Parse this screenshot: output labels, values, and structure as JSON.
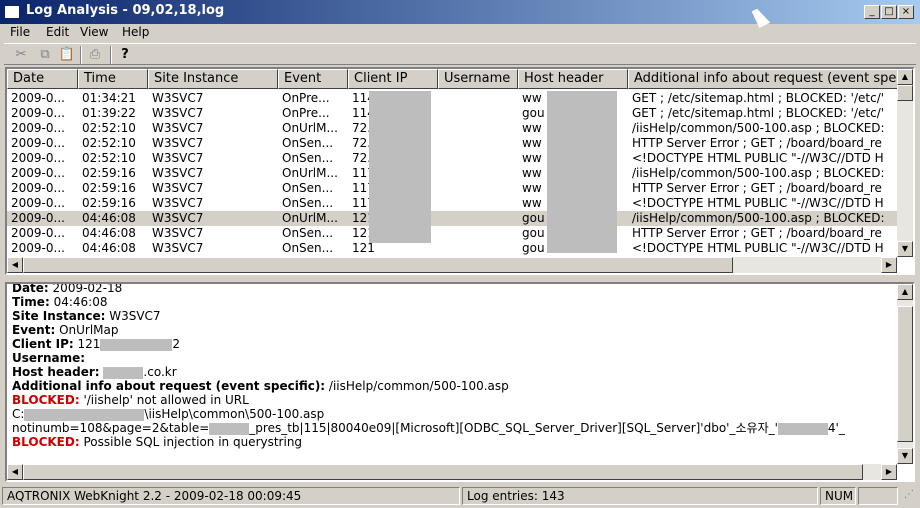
{
  "window": {
    "title": "Log Analysis - 09,02,18,log"
  },
  "menu": [
    "File",
    "Edit",
    "View",
    "Help"
  ],
  "toolbar": {
    "tools": [
      {
        "icon": "cut-icon",
        "glyph": "✂",
        "enabled": false
      },
      {
        "icon": "copy-icon",
        "glyph": "⧉",
        "enabled": false
      },
      {
        "icon": "paste-icon",
        "glyph": "📋",
        "enabled": false
      },
      {
        "icon": "print-icon",
        "glyph": "⎙",
        "enabled": false
      },
      {
        "icon": "help-icon",
        "glyph": "?",
        "enabled": true
      }
    ]
  },
  "table": {
    "columns": [
      "Date",
      "Time",
      "Site Instance",
      "Event",
      "Client IP",
      "Username",
      "Host header",
      "Additional info about request (event specific)"
    ],
    "rows": [
      [
        "2009-0...",
        "01:34:21",
        "W3SVC7",
        "OnPre...",
        "114",
        "",
        "ww",
        "GET ; /etc/sitemap.html ; BLOCKED: '/etc/'"
      ],
      [
        "2009-0...",
        "01:39:22",
        "W3SVC7",
        "OnPre...",
        "114",
        "",
        "gou",
        "GET ; /etc/sitemap.html ; BLOCKED: '/etc/'"
      ],
      [
        "2009-0...",
        "02:52:10",
        "W3SVC7",
        "OnUrlM...",
        "72.",
        "",
        "ww",
        "/iisHelp/common/500-100.asp ; BLOCKED:"
      ],
      [
        "2009-0...",
        "02:52:10",
        "W3SVC7",
        "OnSen...",
        "72.",
        "",
        "ww",
        "HTTP Server Error ; GET ; /board/board_re"
      ],
      [
        "2009-0...",
        "02:52:10",
        "W3SVC7",
        "OnSen...",
        "72.",
        "",
        "ww",
        "  <!DOCTYPE HTML PUBLIC \"-//W3C//DTD H"
      ],
      [
        "2009-0...",
        "02:59:16",
        "W3SVC7",
        "OnUrlM...",
        "117",
        "",
        "ww",
        "/iisHelp/common/500-100.asp ; BLOCKED:"
      ],
      [
        "2009-0...",
        "02:59:16",
        "W3SVC7",
        "OnSen...",
        "117",
        "",
        "ww",
        "HTTP Server Error ; GET ; /board/board_re"
      ],
      [
        "2009-0...",
        "02:59:16",
        "W3SVC7",
        "OnSen...",
        "117",
        "",
        "ww",
        "  <!DOCTYPE HTML PUBLIC \"-//W3C//DTD H"
      ],
      [
        "2009-0...",
        "04:46:08",
        "W3SVC7",
        "OnUrlM...",
        "121",
        "",
        "gou",
        "/iisHelp/common/500-100.asp ; BLOCKED:"
      ],
      [
        "2009-0...",
        "04:46:08",
        "W3SVC7",
        "OnSen...",
        "121",
        "",
        "gou",
        "HTTP Server Error ; GET ; /board/board_re"
      ],
      [
        "2009-0...",
        "04:46:08",
        "W3SVC7",
        "OnSen...",
        "121",
        "",
        "gou",
        "  <!DOCTYPE HTML PUBLIC \"-//W3C//DTD H"
      ]
    ],
    "selected_row": 8
  },
  "detail": {
    "date_label": "Date:",
    "date_value": " 2009-02-18",
    "time_label": "Time:",
    "time_value": " 04:46:08",
    "site_label": "Site Instance:",
    "site_value": " W3SVC7",
    "event_label": "Event:",
    "event_value": " OnUrlMap",
    "clientip_label": "Client IP:",
    "clientip_value": " 121",
    "clientip_tail": "2",
    "username_label": "Username:",
    "host_label": "Host header:",
    "host_value": ".co.kr",
    "addinfo_label": "Additional info about request (event specific):",
    "addinfo_value": " /iisHelp/common/500-100.asp",
    "blocked1_label": "BLOCKED:",
    "blocked1_value": " '/iishelp' not allowed in URL",
    "path_prefix": "C:",
    "path_value": "\\iisHelp\\common\\500-100.asp",
    "query_prefix": "notinumb=108&page=2&table=",
    "query_value": "_pres_tb|115|80040e09|[Microsoft][ODBC_SQL_Server_Driver][SQL_Server]'dbo'_소유자_'",
    "query_tail": "4'_",
    "blocked2_label": "BLOCKED:",
    "blocked2_value": " Possible SQL injection in querystring"
  },
  "status": {
    "app": "AQTRONIX WebKnight 2.2 - 2009-02-18 00:09:45",
    "entries": "Log entries: 143",
    "num": "NUM"
  }
}
